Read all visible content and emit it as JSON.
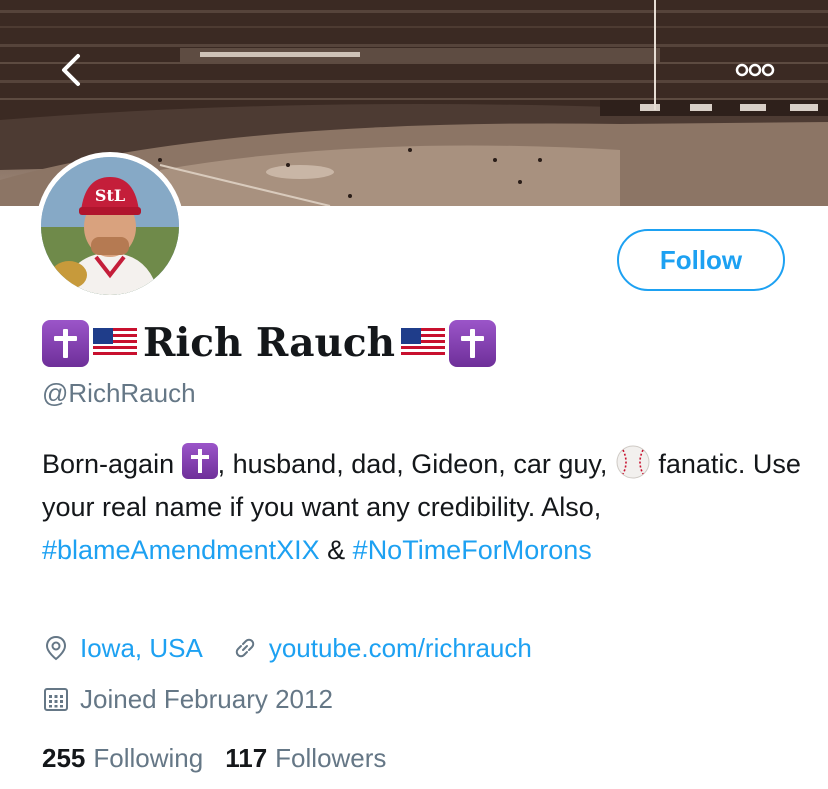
{
  "header": {
    "back_icon": "chevron-left-icon",
    "more_icon": "more-horizontal-icon"
  },
  "profile": {
    "name": "Rich Rauch",
    "handle": "@RichRauch",
    "follow_label": "Follow",
    "name_emoji": [
      "latin-cross-emoji",
      "us-flag-emoji"
    ]
  },
  "bio": {
    "part1": "Born-again ",
    "part2": ", husband, dad, Gideon, car guy, ",
    "part3": " fanatic. Use your real name if you want any credibility. Also, ",
    "hashtag1": "#blameAmendmentXIX",
    "part4": " & ",
    "hashtag2": "#NoTimeForMorons"
  },
  "meta": {
    "location": "Iowa, USA",
    "website": "youtube.com/richrauch",
    "joined": "Joined February 2012"
  },
  "stats": {
    "following_count": "255",
    "following_label": "Following",
    "followers_count": "117",
    "followers_label": "Followers"
  },
  "colors": {
    "accent": "#1da1f2",
    "secondary_text": "#657786",
    "primary_text": "#14171a"
  }
}
